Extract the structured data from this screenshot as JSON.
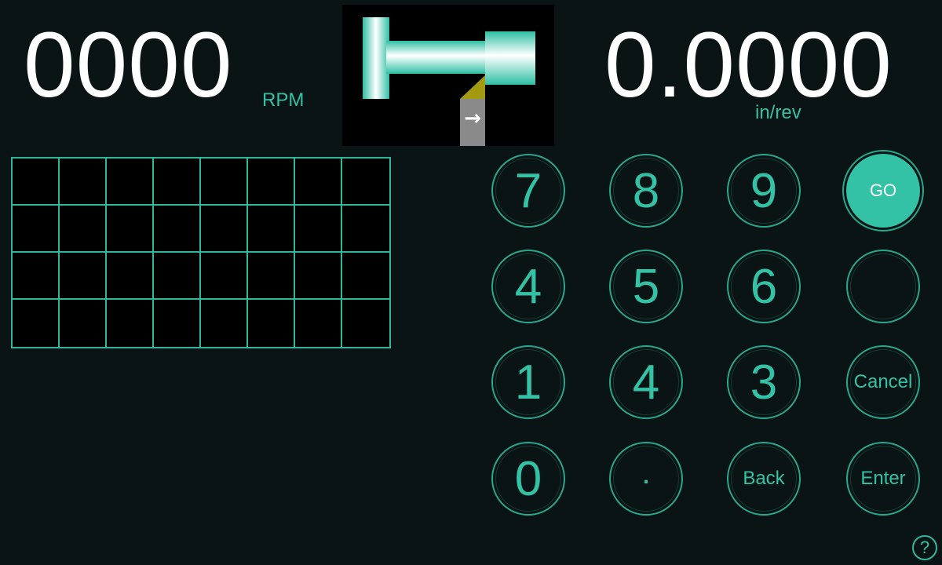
{
  "readouts": {
    "rpm_value": "0000",
    "rpm_unit": "RPM",
    "feed_value": "0.0000",
    "feed_unit": "in/rev"
  },
  "illustration": {
    "name": "lathe-spindle-tool",
    "direction_arrow": "→"
  },
  "keypad": {
    "k7": "7",
    "k8": "8",
    "k9": "9",
    "go": "GO",
    "k4": "4",
    "k5": "5",
    "k6": "6",
    "blank": "",
    "k1": "1",
    "k4b": "4",
    "k3": "3",
    "cancel": "Cancel",
    "k0": "0",
    "dot": ".",
    "back": "Back",
    "enter": "Enter"
  },
  "help": {
    "label": "?"
  },
  "colors": {
    "background": "#0b1414",
    "accent": "#33c2a6",
    "grid_line": "#2fb79c",
    "tool_tip": "#a39a12",
    "tool_body": "#8a8a8a"
  }
}
